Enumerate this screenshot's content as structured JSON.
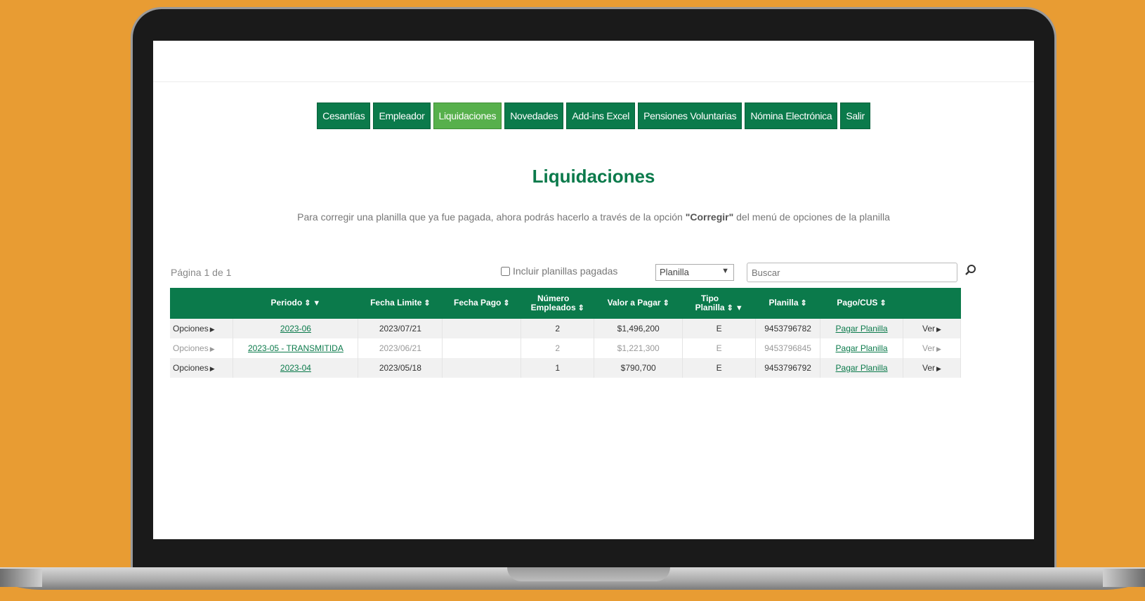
{
  "nav": {
    "items": [
      {
        "label": "Cesantías",
        "active": false
      },
      {
        "label": "Empleador",
        "active": false
      },
      {
        "label": "Liquidaciones",
        "active": true
      },
      {
        "label": "Novedades",
        "active": false
      },
      {
        "label": "Add-ins Excel",
        "active": false
      },
      {
        "label": "Pensiones Voluntarias",
        "active": false
      },
      {
        "label": "Nómina Electrónica",
        "active": false
      },
      {
        "label": "Salir",
        "active": false
      }
    ]
  },
  "page": {
    "title": "Liquidaciones",
    "notice_pre": "Para corregir una planilla que ya fue pagada, ahora podrás hacerlo a través de la opción ",
    "notice_bold": "\"Corregir\"",
    "notice_post": " del menú de opciones de la planilla"
  },
  "toolbar": {
    "page_info": "Página 1 de 1",
    "include_label": "Incluir planillas pagadas",
    "select_value": "Planilla",
    "search_placeholder": "Buscar"
  },
  "table": {
    "headers": {
      "periodo": "Periodo",
      "fecha_limite": "Fecha Limite",
      "fecha_pago": "Fecha Pago",
      "numero_empleados_1": "Número",
      "numero_empleados_2": "Empleados",
      "valor_pagar": "Valor a Pagar",
      "tipo_planilla_1": "Tipo",
      "tipo_planilla_2": "Planilla",
      "planilla": "Planilla",
      "pago_cus": "Pago/CUS"
    },
    "rows": [
      {
        "opciones": "Opciones",
        "periodo": "2023-06",
        "fecha_limite": "2023/07/21",
        "fecha_pago": "",
        "empleados": "2",
        "valor": "$1,496,200",
        "tipo": "E",
        "planilla": "9453796782",
        "pago": "Pagar Planilla",
        "ver": "Ver"
      },
      {
        "opciones": "Opciones",
        "periodo": "2023-05 - TRANSMITIDA",
        "fecha_limite": "2023/06/21",
        "fecha_pago": "",
        "empleados": "2",
        "valor": "$1,221,300",
        "tipo": "E",
        "planilla": "9453796845",
        "pago": "Pagar Planilla",
        "ver": "Ver"
      },
      {
        "opciones": "Opciones",
        "periodo": "2023-04",
        "fecha_limite": "2023/05/18",
        "fecha_pago": "",
        "empleados": "1",
        "valor": "$790,700",
        "tipo": "E",
        "planilla": "9453796792",
        "pago": "Pagar Planilla",
        "ver": "Ver"
      }
    ]
  }
}
